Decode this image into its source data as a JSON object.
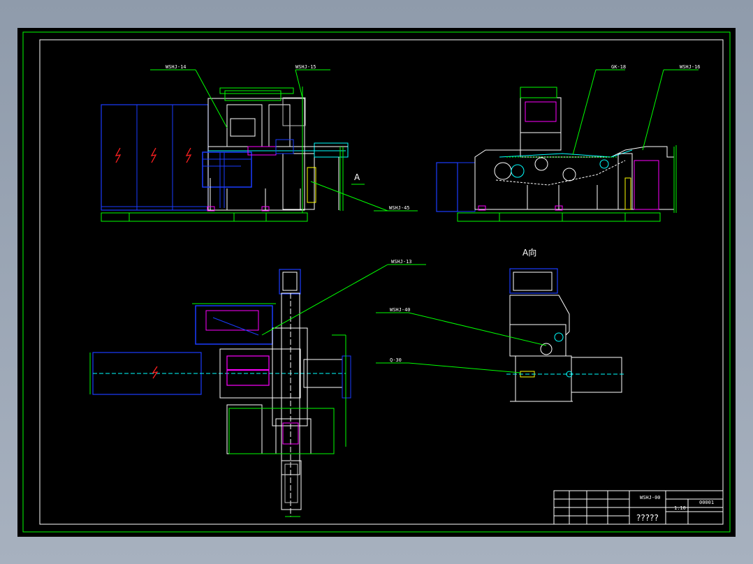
{
  "drawing": {
    "callouts": {
      "wshj_14": "WSHJ-14",
      "wshj_15": "WSHJ-15",
      "gk_18": "GK-18",
      "wshj_16": "WSHJ-16",
      "wshj_45": "WSHJ-45",
      "wshj_13": "WSHJ-13",
      "wshj_40": "WSHJ-40",
      "q_30": "Q-30"
    },
    "view_marker": "A",
    "view_title": "A向",
    "title_block": {
      "drawing_no": "WSHJ-00",
      "sheet_code": "00001",
      "name": "?????",
      "scale": "1:10"
    }
  },
  "colors": {
    "frame": "#00ff00",
    "blue": "#1a3cff",
    "white": "#ffffff",
    "magenta": "#ff00ff",
    "cyan": "#00ffff",
    "yellow": "#ffff00",
    "red": "#ff2020",
    "gray": "#c0c0c0"
  }
}
